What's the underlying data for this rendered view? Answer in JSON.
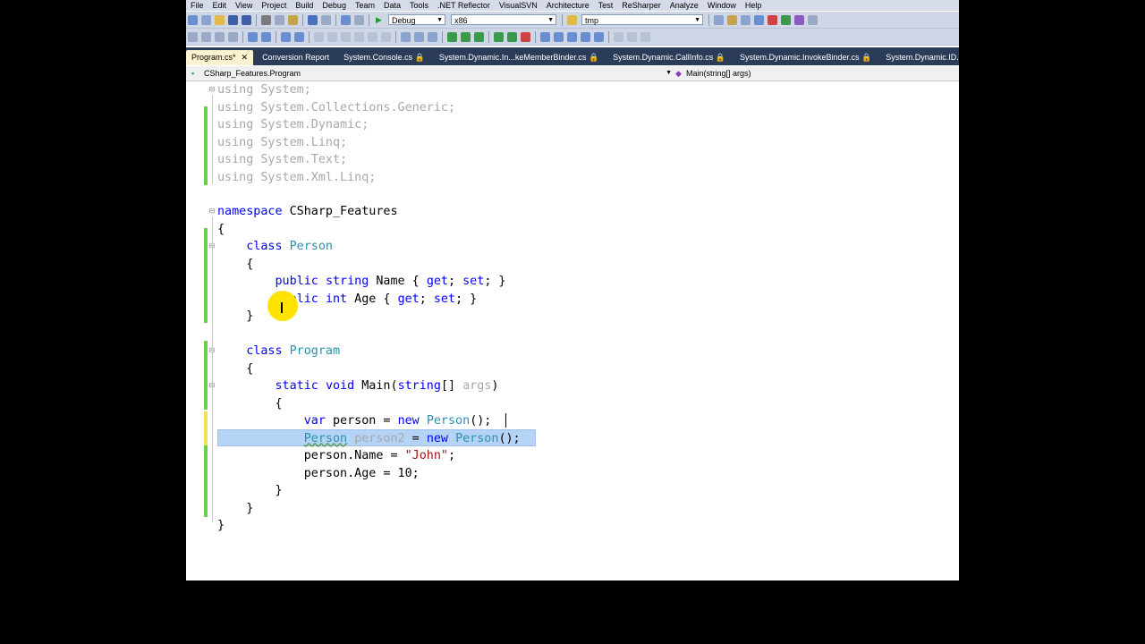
{
  "menu": [
    "File",
    "Edit",
    "View",
    "Project",
    "Build",
    "Debug",
    "Team",
    "Data",
    "Tools",
    ".NET Reflector",
    "VisualSVN",
    "Architecture",
    "Test",
    "ReSharper",
    "Analyze",
    "Window",
    "Help"
  ],
  "toolbar": {
    "config": "Debug",
    "platform": "x86",
    "find_text": "tmp"
  },
  "tabs": [
    {
      "label": "Program.cs*",
      "active": true,
      "closable": true
    },
    {
      "label": "Conversion Report",
      "active": false
    },
    {
      "label": "System.Console.cs",
      "active": false,
      "locked": true
    },
    {
      "label": "System.Dynamic.In...keMemberBinder.cs",
      "active": false,
      "locked": true
    },
    {
      "label": "System.Dynamic.CallInfo.cs",
      "active": false,
      "locked": true
    },
    {
      "label": "System.Dynamic.InvokeBinder.cs",
      "active": false,
      "locked": true
    },
    {
      "label": "System.Dynamic.ID...aO",
      "active": false,
      "locked": true
    }
  ],
  "nav": {
    "type": "CSharp_Features.Program",
    "member": "Main(string[] args)"
  },
  "code": {
    "l1": {
      "a": "using",
      "b": " System;"
    },
    "l2": {
      "a": "using",
      "b": " System.Collections.Generic;"
    },
    "l3": {
      "a": "using",
      "b": " System.Dynamic;"
    },
    "l4": {
      "a": "using",
      "b": " System.Linq;"
    },
    "l5": {
      "a": "using",
      "b": " System.Text;"
    },
    "l6": {
      "a": "using",
      "b": " System.Xml.Linq;"
    },
    "l8": {
      "a": "namespace",
      "b": " CSharp_Features"
    },
    "l9": "{",
    "l10": {
      "a": "class",
      "b": "Person"
    },
    "l11": "{",
    "l12": {
      "a": "public",
      "b": "string",
      "c": " Name { ",
      "d": "get",
      "e": "; ",
      "f": "set",
      "g": "; }"
    },
    "l13": {
      "a": "public",
      "b": "int",
      "c": " Age { ",
      "d": "get",
      "e": "; ",
      "f": "set",
      "g": "; }"
    },
    "l14": "}",
    "l16": {
      "a": "class",
      "b": "Program"
    },
    "l17": "{",
    "l18": {
      "a": "static",
      "b": "void",
      "c": " Main(",
      "d": "string",
      "e": "[] ",
      "f": "args",
      ")": ")"
    },
    "l19": "{",
    "l20": {
      "a": "var",
      "b": " person = ",
      "c": "new",
      "d": "Person",
      "e": "();"
    },
    "l21": {
      "a": "Person",
      "b": "person2",
      "c": " = ",
      "d": "new",
      "e": "Person",
      "f": "();"
    },
    "l22": {
      "a": "person.Name = ",
      "b": "\"John\"",
      "c": ";"
    },
    "l23": "person.Age = 10;",
    "l24": "}",
    "l25": "}",
    "l26": "}"
  }
}
